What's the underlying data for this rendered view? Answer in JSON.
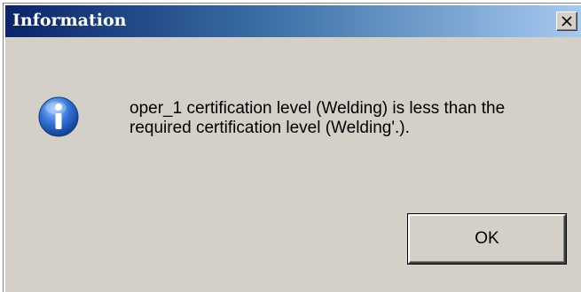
{
  "window": {
    "title": "Information",
    "close_icon": "close-icon",
    "close_label": "x"
  },
  "content": {
    "icon": "info-icon",
    "message_line_1": "oper_1 certification level (Welding) is less than the",
    "message_line_2": "required certification level (Welding'.)."
  },
  "buttons": {
    "ok_label": "OK"
  },
  "colors": {
    "titlebar_start": "#0a246a",
    "titlebar_end": "#a6caf0",
    "dialog_bg": "#d4d0c8",
    "icon_blue": "#1f5fbf"
  }
}
